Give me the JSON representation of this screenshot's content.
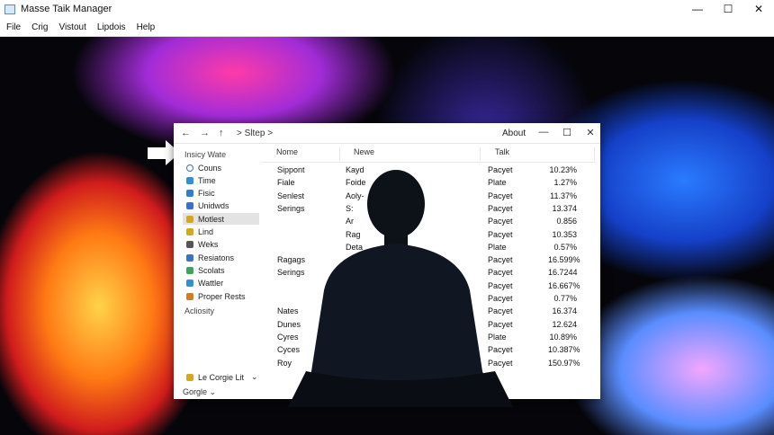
{
  "app": {
    "title": "Masse Taik Manager"
  },
  "window_controls": {
    "minimize": "—",
    "maximize": "☐",
    "close": "✕"
  },
  "menu": [
    "File",
    "Crig",
    "Vistout",
    "Lipdois",
    "Help"
  ],
  "inner": {
    "breadcrumb": "> Sltep  >",
    "about": "About",
    "controls": {
      "minimize": "—",
      "maximize": "☐",
      "close": "✕"
    }
  },
  "sidebar": {
    "header": "Insicy Wate",
    "items": [
      {
        "label": "Couns",
        "icon": "search-icon",
        "color": "#3a72c8"
      },
      {
        "label": "Time",
        "icon": "music-icon",
        "color": "#2f8fd8"
      },
      {
        "label": "Fisic",
        "icon": "image-icon",
        "color": "#2d7fd3"
      },
      {
        "label": "Unidwds",
        "icon": "window-icon",
        "color": "#3b6fd1"
      },
      {
        "label": "Motlest",
        "icon": "music-icon",
        "color": "#d4a81d"
      },
      {
        "label": "Lind",
        "icon": "note-icon",
        "color": "#d4a81d"
      },
      {
        "label": "Weks",
        "icon": "music-icon",
        "color": "#555555"
      },
      {
        "label": "Resiatons",
        "icon": "music-icon",
        "color": "#3a72c8"
      },
      {
        "label": "Scolats",
        "icon": "grid-icon",
        "color": "#3ca55c"
      },
      {
        "label": "Wattler",
        "icon": "link-icon",
        "color": "#2f8fd8"
      },
      {
        "label": "Proper Rests",
        "icon": "phone-icon",
        "color": "#cf7b28"
      }
    ],
    "section": "Acliosity",
    "footer_label": "Le Corgie Lit",
    "footer_bottom": "Gorgle ⌄"
  },
  "table": {
    "columns": [
      "Nome",
      "Newe",
      "",
      "Talk"
    ],
    "rows": [
      {
        "name": "Sippont",
        "newe": "Kayd",
        "talk": "Pacyet",
        "pct": "10.23%"
      },
      {
        "name": "Fiale",
        "newe": "Foide",
        "talk": "Plate",
        "pct": "1.27%"
      },
      {
        "name": "Senlest",
        "newe": "Aoly-",
        "talk": "Pacyet",
        "pct": "11.37%"
      },
      {
        "name": "Serings",
        "newe": "S:",
        "talk": "Pacyet",
        "pct": "13.374"
      },
      {
        "name": "",
        "newe": "Ar",
        "talk": "Pacyet",
        "pct": "0.856"
      },
      {
        "name": "",
        "newe": "Rag",
        "talk": "Pacyet",
        "pct": "10.353"
      },
      {
        "name": "",
        "newe": "Deta",
        "talk": "Plate",
        "pct": "0.57%"
      },
      {
        "name": "Ragags",
        "newe": "",
        "talk": "Pacyet",
        "pct": "16.599%"
      },
      {
        "name": "Serings",
        "newe": "",
        "talk": "Pacyet",
        "pct": "16.7244"
      },
      {
        "name": "",
        "newe": "",
        "talk": "Pacyet",
        "pct": "16.667%"
      },
      {
        "name": "",
        "newe": "",
        "talk": "Pacyet",
        "pct": "0.77%"
      },
      {
        "name": "Nates",
        "newe": "",
        "talk": "Pacyet",
        "pct": "16.374"
      },
      {
        "name": "Dunes",
        "newe": "",
        "talk": "Pacyet",
        "pct": "12.624"
      },
      {
        "name": "Cyres",
        "newe": "",
        "talk": "Plate",
        "pct": "10.89%"
      },
      {
        "name": "Cyces",
        "newe": "",
        "talk": "Pacyet",
        "pct": "10.387%"
      },
      {
        "name": "Roy",
        "newe": "",
        "talk": "Pacyet",
        "pct": "150.97%"
      }
    ]
  }
}
